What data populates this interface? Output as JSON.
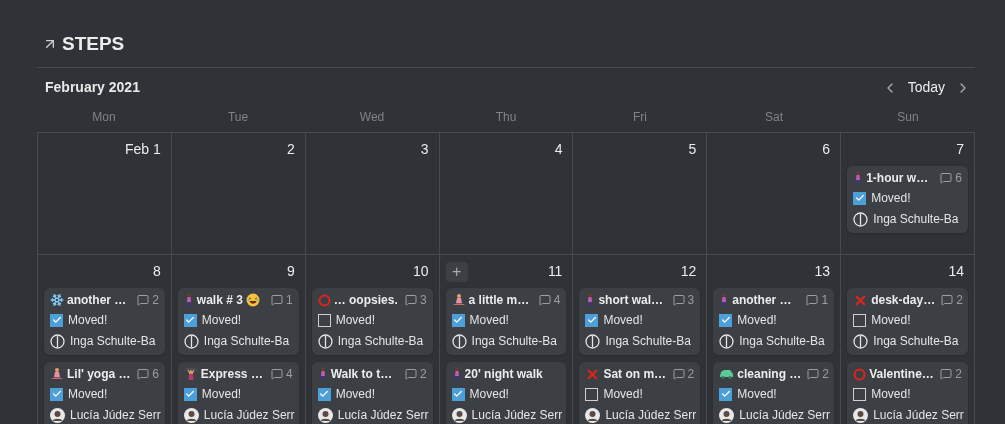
{
  "page": {
    "title": "STEPS"
  },
  "calendar": {
    "month": "February 2021",
    "today_button": "Today",
    "weekdays": [
      "Mon",
      "Tue",
      "Wed",
      "Thu",
      "Fri",
      "Sat",
      "Sun"
    ],
    "weeks": [
      {
        "days": [
          {
            "label": "Feb 1"
          },
          {
            "label": "2"
          },
          {
            "label": "3"
          },
          {
            "label": "4"
          },
          {
            "label": "5"
          },
          {
            "label": "6"
          },
          {
            "label": "7",
            "cards": [
              {
                "icon": {
                  "kind": "walking"
                },
                "title": "1-hour w…",
                "comments": "6",
                "checkbox": {
                  "label": "Moved!",
                  "checked": true
                },
                "person": {
                  "name": "Inga Schulte-Ba",
                  "avatar": {
                    "kind": "initial"
                  }
                }
              }
            ]
          }
        ]
      },
      {
        "days": [
          {
            "label": "8",
            "cards": [
              {
                "icon": {
                  "kind": "snowflake"
                },
                "title": "another …",
                "comments": "2",
                "checkbox": {
                  "label": "Moved!",
                  "checked": true
                },
                "person": {
                  "name": "Inga Schulte-Ba",
                  "avatar": {
                    "kind": "initial"
                  }
                }
              },
              {
                "icon": {
                  "kind": "yoga"
                },
                "title": "Lil' yoga …",
                "comments": "6",
                "checkbox": {
                  "label": "Moved!",
                  "checked": true
                },
                "person": {
                  "name": "Lucía Júdez Serr",
                  "avatar": {
                    "kind": "photo"
                  }
                }
              }
            ]
          },
          {
            "label": "9",
            "cards": [
              {
                "icon": {
                  "kind": "walking"
                },
                "title": "walk # 3",
                "emoji": {
                  "kind": "laughing"
                },
                "comments": "1",
                "checkbox": {
                  "label": "Moved!",
                  "checked": true
                },
                "person": {
                  "name": "Inga Schulte-Ba",
                  "avatar": {
                    "kind": "initial"
                  }
                }
              },
              {
                "icon": {
                  "kind": "weightlifter"
                },
                "title": "Express …",
                "comments": "4",
                "checkbox": {
                  "label": "Moved!",
                  "checked": true
                },
                "person": {
                  "name": "Lucía Júdez Serr",
                  "avatar": {
                    "kind": "photo"
                  }
                }
              }
            ]
          },
          {
            "label": "10",
            "cards": [
              {
                "icon": {
                  "kind": "circle"
                },
                "title": "… oopsies.",
                "comments": "3",
                "checkbox": {
                  "label": "Moved!",
                  "checked": false
                },
                "person": {
                  "name": "Inga Schulte-Ba",
                  "avatar": {
                    "kind": "initial"
                  }
                }
              },
              {
                "icon": {
                  "kind": "walking"
                },
                "title": "Walk to t…",
                "comments": "2",
                "checkbox": {
                  "label": "Moved!",
                  "checked": true
                },
                "person": {
                  "name": "Lucía Júdez Serr",
                  "avatar": {
                    "kind": "photo"
                  }
                }
              }
            ]
          },
          {
            "label": "11",
            "add_button": "+",
            "cards": [
              {
                "icon": {
                  "kind": "yoga"
                },
                "title": "a little m…",
                "comments": "4",
                "checkbox": {
                  "label": "Moved!",
                  "checked": true
                },
                "person": {
                  "name": "Inga Schulte-Ba",
                  "avatar": {
                    "kind": "initial"
                  }
                }
              },
              {
                "icon": {
                  "kind": "walking"
                },
                "title": "20' night walk",
                "checkbox": {
                  "label": "Moved!",
                  "checked": true
                },
                "person": {
                  "name": "Lucía Júdez Serr",
                  "avatar": {
                    "kind": "photo"
                  }
                }
              }
            ]
          },
          {
            "label": "12",
            "cards": [
              {
                "icon": {
                  "kind": "walking"
                },
                "title": "short wal…",
                "comments": "3",
                "checkbox": {
                  "label": "Moved!",
                  "checked": true
                },
                "person": {
                  "name": "Inga Schulte-Ba",
                  "avatar": {
                    "kind": "initial"
                  }
                }
              },
              {
                "icon": {
                  "kind": "cross"
                },
                "title": "Sat on m…",
                "comments": "2",
                "checkbox": {
                  "label": "Moved!",
                  "checked": false
                },
                "person": {
                  "name": "Lucía Júdez Serr",
                  "avatar": {
                    "kind": "photo"
                  }
                }
              }
            ]
          },
          {
            "label": "13",
            "cards": [
              {
                "icon": {
                  "kind": "walking"
                },
                "title": "another …",
                "comments": "1",
                "checkbox": {
                  "label": "Moved!",
                  "checked": true
                },
                "person": {
                  "name": "Inga Schulte-Ba",
                  "avatar": {
                    "kind": "initial"
                  }
                }
              },
              {
                "icon": {
                  "kind": "car"
                },
                "title": "cleaning …",
                "comments": "2",
                "checkbox": {
                  "label": "Moved!",
                  "checked": true
                },
                "person": {
                  "name": "Lucía Júdez Serr",
                  "avatar": {
                    "kind": "photo"
                  }
                }
              }
            ]
          },
          {
            "label": "14",
            "cards": [
              {
                "icon": {
                  "kind": "cross"
                },
                "title": "desk-day…",
                "comments": "2",
                "checkbox": {
                  "label": "Moved!",
                  "checked": false
                },
                "person": {
                  "name": "Inga Schulte-Ba",
                  "avatar": {
                    "kind": "initial"
                  }
                }
              },
              {
                "icon": {
                  "kind": "circle"
                },
                "title": "Valentine…",
                "comments": "2",
                "checkbox": {
                  "label": "Moved!",
                  "checked": false
                },
                "person": {
                  "name": "Lucía Júdez Serr",
                  "avatar": {
                    "kind": "photo"
                  }
                }
              }
            ]
          }
        ]
      }
    ]
  }
}
